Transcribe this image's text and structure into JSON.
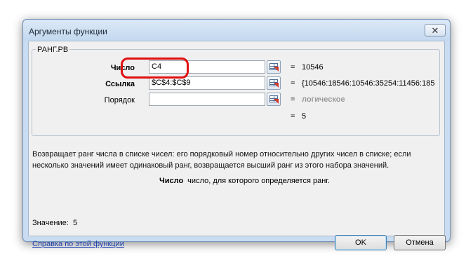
{
  "dialog": {
    "title": "Аргументы функции",
    "close_glyph": "✕",
    "function_name": "РАНГ.РВ"
  },
  "args": [
    {
      "label": "Число",
      "value": "C4",
      "result": "10546"
    },
    {
      "label": "Ссылка",
      "value": "$C$4:$C$9",
      "result": "{10546:18546:10546:35254:11456:185"
    },
    {
      "label": "Порядок",
      "value": "",
      "result": "логическое"
    }
  ],
  "equals_sign": "=",
  "formula_result": "5",
  "description": "Возвращает ранг числа в списке чисел: его порядковый номер относительно других чисел в списке; если несколько значений имеет одинаковый ранг, возвращается высший ранг из этого набора значений.",
  "param_help": {
    "name": "Число",
    "text": "число, для которого определяется ранг."
  },
  "value_label": "Значение:",
  "value": "5",
  "help_link": "Справка по этой функции",
  "buttons": {
    "ok": "OK",
    "cancel": "Отмена"
  },
  "colors": {
    "highlight": "#e01010",
    "link": "#1a3fb0"
  },
  "icons": {
    "ref_button": "collapse-dialog-icon"
  }
}
